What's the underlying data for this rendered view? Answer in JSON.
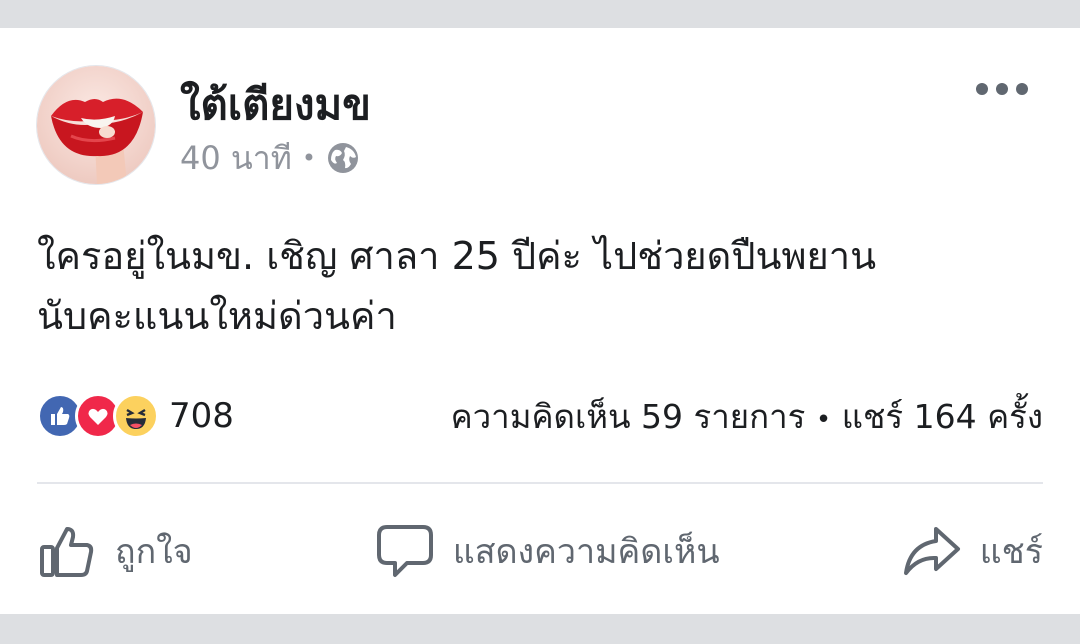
{
  "post": {
    "author": "ใต้เตียงมข",
    "timestamp": "40 นาที",
    "separator": "•",
    "privacy_icon": "globe-icon",
    "text_line1": "ใครอยู่ในมข. เชิญ ศาลา 25 ปีค่ะ ไปช่วยดปืนพยาน",
    "text_line2": "นับคะแนนใหม่ด่วนค่า"
  },
  "reactions": {
    "icons": [
      "like-reaction-icon",
      "love-reaction-icon",
      "haha-reaction-icon"
    ],
    "count": "708"
  },
  "stats": {
    "comments": "ความคิดเห็น 59 รายการ",
    "separator": "•",
    "shares": "แชร์ 164 ครั้ง"
  },
  "actions": {
    "like": "ถูกใจ",
    "comment": "แสดงความคิดเห็น",
    "share": "แชร์"
  },
  "colors": {
    "like_blue": "#4267b2",
    "love_red": "#f0284a",
    "haha_yellow": "#fcd15e",
    "muted_text": "#90949c",
    "action_gray": "#606770"
  }
}
